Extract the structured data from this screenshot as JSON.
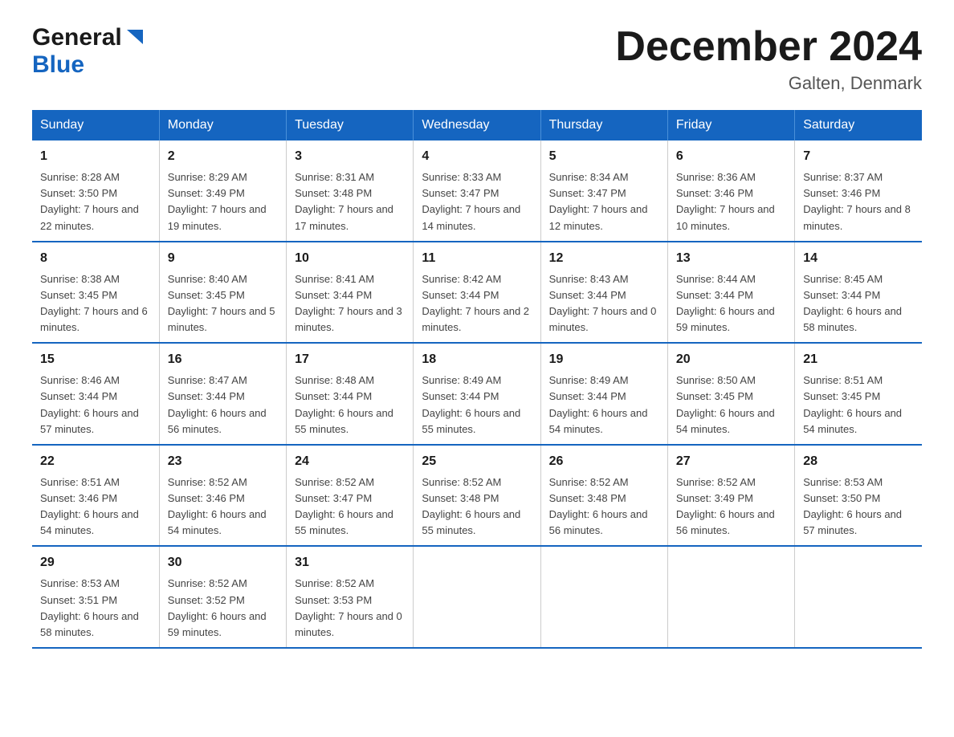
{
  "header": {
    "logo_general": "General",
    "logo_blue": "Blue",
    "title": "December 2024",
    "subtitle": "Galten, Denmark"
  },
  "weekdays": [
    "Sunday",
    "Monday",
    "Tuesday",
    "Wednesday",
    "Thursday",
    "Friday",
    "Saturday"
  ],
  "weeks": [
    [
      {
        "day": "1",
        "sunrise": "8:28 AM",
        "sunset": "3:50 PM",
        "daylight": "7 hours and 22 minutes."
      },
      {
        "day": "2",
        "sunrise": "8:29 AM",
        "sunset": "3:49 PM",
        "daylight": "7 hours and 19 minutes."
      },
      {
        "day": "3",
        "sunrise": "8:31 AM",
        "sunset": "3:48 PM",
        "daylight": "7 hours and 17 minutes."
      },
      {
        "day": "4",
        "sunrise": "8:33 AM",
        "sunset": "3:47 PM",
        "daylight": "7 hours and 14 minutes."
      },
      {
        "day": "5",
        "sunrise": "8:34 AM",
        "sunset": "3:47 PM",
        "daylight": "7 hours and 12 minutes."
      },
      {
        "day": "6",
        "sunrise": "8:36 AM",
        "sunset": "3:46 PM",
        "daylight": "7 hours and 10 minutes."
      },
      {
        "day": "7",
        "sunrise": "8:37 AM",
        "sunset": "3:46 PM",
        "daylight": "7 hours and 8 minutes."
      }
    ],
    [
      {
        "day": "8",
        "sunrise": "8:38 AM",
        "sunset": "3:45 PM",
        "daylight": "7 hours and 6 minutes."
      },
      {
        "day": "9",
        "sunrise": "8:40 AM",
        "sunset": "3:45 PM",
        "daylight": "7 hours and 5 minutes."
      },
      {
        "day": "10",
        "sunrise": "8:41 AM",
        "sunset": "3:44 PM",
        "daylight": "7 hours and 3 minutes."
      },
      {
        "day": "11",
        "sunrise": "8:42 AM",
        "sunset": "3:44 PM",
        "daylight": "7 hours and 2 minutes."
      },
      {
        "day": "12",
        "sunrise": "8:43 AM",
        "sunset": "3:44 PM",
        "daylight": "7 hours and 0 minutes."
      },
      {
        "day": "13",
        "sunrise": "8:44 AM",
        "sunset": "3:44 PM",
        "daylight": "6 hours and 59 minutes."
      },
      {
        "day": "14",
        "sunrise": "8:45 AM",
        "sunset": "3:44 PM",
        "daylight": "6 hours and 58 minutes."
      }
    ],
    [
      {
        "day": "15",
        "sunrise": "8:46 AM",
        "sunset": "3:44 PM",
        "daylight": "6 hours and 57 minutes."
      },
      {
        "day": "16",
        "sunrise": "8:47 AM",
        "sunset": "3:44 PM",
        "daylight": "6 hours and 56 minutes."
      },
      {
        "day": "17",
        "sunrise": "8:48 AM",
        "sunset": "3:44 PM",
        "daylight": "6 hours and 55 minutes."
      },
      {
        "day": "18",
        "sunrise": "8:49 AM",
        "sunset": "3:44 PM",
        "daylight": "6 hours and 55 minutes."
      },
      {
        "day": "19",
        "sunrise": "8:49 AM",
        "sunset": "3:44 PM",
        "daylight": "6 hours and 54 minutes."
      },
      {
        "day": "20",
        "sunrise": "8:50 AM",
        "sunset": "3:45 PM",
        "daylight": "6 hours and 54 minutes."
      },
      {
        "day": "21",
        "sunrise": "8:51 AM",
        "sunset": "3:45 PM",
        "daylight": "6 hours and 54 minutes."
      }
    ],
    [
      {
        "day": "22",
        "sunrise": "8:51 AM",
        "sunset": "3:46 PM",
        "daylight": "6 hours and 54 minutes."
      },
      {
        "day": "23",
        "sunrise": "8:52 AM",
        "sunset": "3:46 PM",
        "daylight": "6 hours and 54 minutes."
      },
      {
        "day": "24",
        "sunrise": "8:52 AM",
        "sunset": "3:47 PM",
        "daylight": "6 hours and 55 minutes."
      },
      {
        "day": "25",
        "sunrise": "8:52 AM",
        "sunset": "3:48 PM",
        "daylight": "6 hours and 55 minutes."
      },
      {
        "day": "26",
        "sunrise": "8:52 AM",
        "sunset": "3:48 PM",
        "daylight": "6 hours and 56 minutes."
      },
      {
        "day": "27",
        "sunrise": "8:52 AM",
        "sunset": "3:49 PM",
        "daylight": "6 hours and 56 minutes."
      },
      {
        "day": "28",
        "sunrise": "8:53 AM",
        "sunset": "3:50 PM",
        "daylight": "6 hours and 57 minutes."
      }
    ],
    [
      {
        "day": "29",
        "sunrise": "8:53 AM",
        "sunset": "3:51 PM",
        "daylight": "6 hours and 58 minutes."
      },
      {
        "day": "30",
        "sunrise": "8:52 AM",
        "sunset": "3:52 PM",
        "daylight": "6 hours and 59 minutes."
      },
      {
        "day": "31",
        "sunrise": "8:52 AM",
        "sunset": "3:53 PM",
        "daylight": "7 hours and 0 minutes."
      },
      null,
      null,
      null,
      null
    ]
  ]
}
